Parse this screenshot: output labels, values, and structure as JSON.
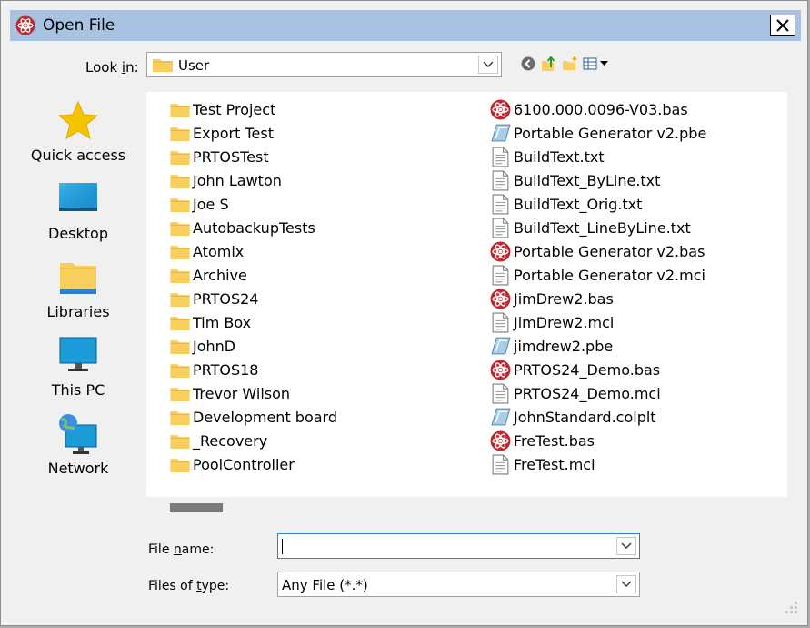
{
  "window": {
    "title": "Open File"
  },
  "toolbar": {
    "look_in_label": "Look in:",
    "look_in_value": "User"
  },
  "places": [
    {
      "label": "Quick access",
      "icon": "star-icon"
    },
    {
      "label": "Desktop",
      "icon": "desktop-icon"
    },
    {
      "label": "Libraries",
      "icon": "libraries-icon"
    },
    {
      "label": "This PC",
      "icon": "this-pc-icon"
    },
    {
      "label": "Network",
      "icon": "network-icon"
    }
  ],
  "folders": [
    "Test Project",
    "Export Test",
    "PRTOSTest",
    "John Lawton",
    "Joe S",
    "AutobackupTests",
    "Atomix",
    "Archive",
    "PRTOS24",
    "Tim Box",
    "JohnD",
    "PRTOS18",
    "Trevor Wilson",
    "Development board",
    "_Recovery",
    "PoolController"
  ],
  "files": [
    {
      "name": "6100.000.0096-V03.bas",
      "type": "bas"
    },
    {
      "name": "Portable Generator v2.pbe",
      "type": "pbe"
    },
    {
      "name": "BuildText.txt",
      "type": "doc"
    },
    {
      "name": "BuildText_ByLine.txt",
      "type": "doc"
    },
    {
      "name": "BuildText_Orig.txt",
      "type": "doc"
    },
    {
      "name": "BuildText_LineByLine.txt",
      "type": "doc"
    },
    {
      "name": "Portable Generator v2.bas",
      "type": "bas"
    },
    {
      "name": "Portable Generator v2.mci",
      "type": "doc"
    },
    {
      "name": "JimDrew2.bas",
      "type": "bas"
    },
    {
      "name": "JimDrew2.mci",
      "type": "doc"
    },
    {
      "name": "jimdrew2.pbe",
      "type": "pbe"
    },
    {
      "name": "PRTOS24_Demo.bas",
      "type": "bas"
    },
    {
      "name": "PRTOS24_Demo.mci",
      "type": "doc"
    },
    {
      "name": "JohnStandard.colplt",
      "type": "pbe"
    },
    {
      "name": "FreTest.bas",
      "type": "bas"
    },
    {
      "name": "FreTest.mci",
      "type": "doc"
    }
  ],
  "form": {
    "file_name_label_pre": "File ",
    "file_name_label_u": "n",
    "file_name_label_post": "ame:",
    "file_name_value": "",
    "file_type_label_pre": "Files of ",
    "file_type_label_u": "t",
    "file_type_label_post": "ype:",
    "file_type_value": "Any File (*.*)"
  },
  "colors": {
    "titlebar": "#a7c3e1",
    "folder": "#f8cf5d",
    "bas_icon": "#c0262d",
    "accent": "#2f7fc8"
  }
}
